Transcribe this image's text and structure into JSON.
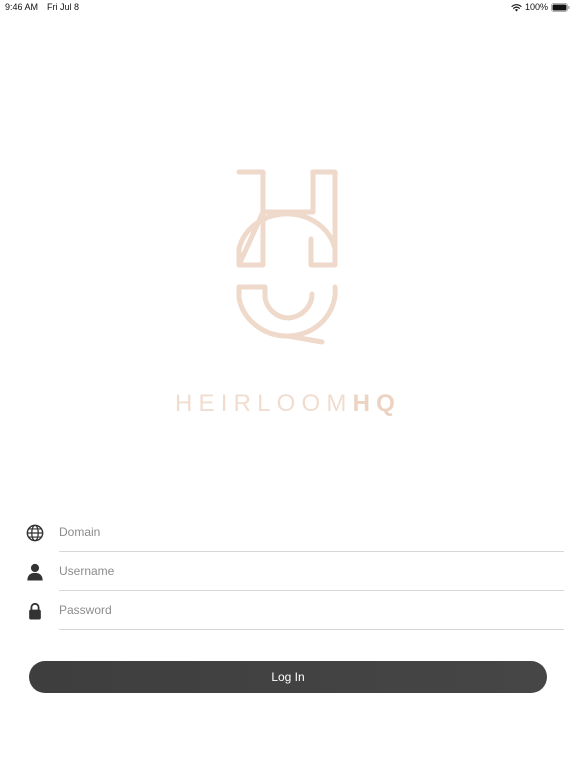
{
  "status_bar": {
    "time": "9:46 AM",
    "date": "Fri Jul 8",
    "battery": "100%",
    "wifi_icon": "wifi-icon",
    "battery_icon": "battery-icon"
  },
  "logo": {
    "word_light": "HEIRLOOM",
    "word_bold": "HQ",
    "color": "#f1ddd0"
  },
  "form": {
    "domain": {
      "placeholder": "Domain",
      "value": "",
      "icon": "globe-icon"
    },
    "username": {
      "placeholder": "Username",
      "value": "",
      "icon": "person-icon"
    },
    "password": {
      "placeholder": "Password",
      "value": "",
      "icon": "lock-icon"
    }
  },
  "login_button": {
    "label": "Log In",
    "color": "#424242"
  }
}
